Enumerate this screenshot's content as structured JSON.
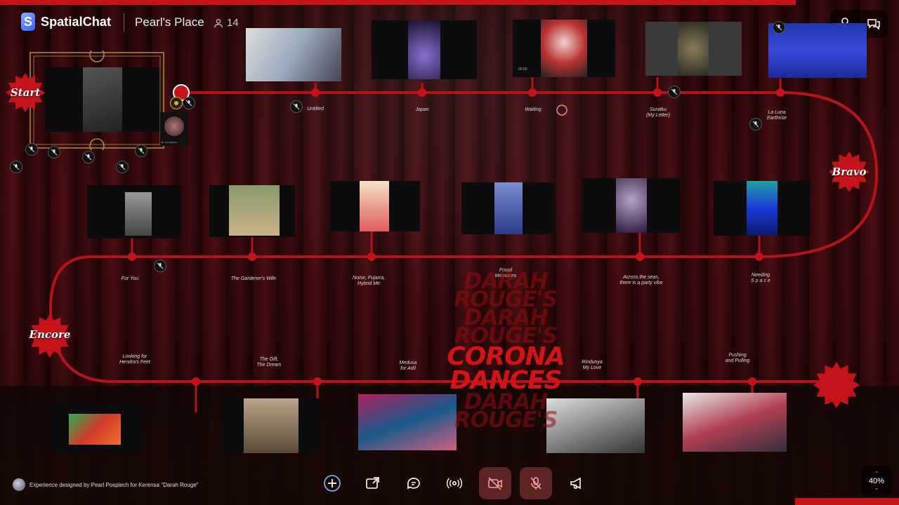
{
  "app": {
    "name": "SpatialChat",
    "space_name": "Pearl's Place",
    "user_count": "14"
  },
  "top_right": {
    "profile_icon": "user-icon",
    "chat_icon": "chat-bubbles-icon"
  },
  "stations": {
    "start": "Start",
    "bravo": "Bravo",
    "encore": "Encore"
  },
  "row1": [
    {
      "title": "Untitled"
    },
    {
      "title": "Japan"
    },
    {
      "title": "Waiting"
    },
    {
      "title": "Suratku\n(My Letter)"
    },
    {
      "title": "La Luna\nEarthrise"
    }
  ],
  "row2": [
    {
      "title": "For You"
    },
    {
      "title": "The Gardener's Wife"
    },
    {
      "title": "Noise, Fujarra,\nHybrid Me"
    },
    {
      "title": "Fossil\nMemories"
    },
    {
      "title": "Across the seas,\nthere is a party vibe"
    },
    {
      "title": "Needing\nS p a c e"
    }
  ],
  "row3": [
    {
      "title": "Looking for\nHendra's Feet"
    },
    {
      "title": "The Gift,\nThe Dream"
    },
    {
      "title": "Medusa\nfor Adil"
    },
    {
      "title": "Rindunya\nMy Love"
    },
    {
      "title": "Pushing\nand Pulling"
    }
  ],
  "show_title": {
    "ghost": "DARAH ROUGE'S",
    "main": "CORONA DANCES"
  },
  "video_time": "00:00",
  "credit": "Experience designed by Pearl Pospiech for Kerensa \"Darah Rouge\"",
  "small_label": "Dr. Joe Abberton",
  "toolbar": {
    "add": "add-icon",
    "share_screen": "share-screen-icon",
    "chat": "chat-icon",
    "broadcast": "broadcast-icon",
    "camera_off": "camera-off-icon",
    "mic_off": "mic-off-icon",
    "megaphone": "megaphone-icon"
  },
  "zoom": {
    "level": "40%"
  },
  "colors": {
    "accent": "#c4141a",
    "track": "#b3141a"
  }
}
